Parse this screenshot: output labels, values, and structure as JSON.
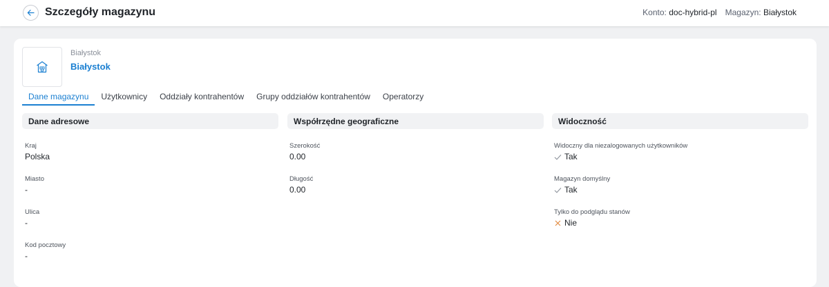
{
  "header": {
    "title": "Szczegóły magazynu",
    "account_label": "Konto:",
    "account_value": "doc-hybrid-pl",
    "warehouse_label": "Magazyn:",
    "warehouse_value": "Białystok"
  },
  "warehouse": {
    "subtitle": "Białystok",
    "name": "Białystok",
    "icon": "warehouse-icon"
  },
  "tabs": [
    {
      "label": "Dane magazynu",
      "active": true
    },
    {
      "label": "Użytkownicy",
      "active": false
    },
    {
      "label": "Oddziały kontrahentów",
      "active": false
    },
    {
      "label": "Grupy oddziałów kontrahentów",
      "active": false
    },
    {
      "label": "Operatorzy",
      "active": false
    }
  ],
  "sections": {
    "address": {
      "title": "Dane adresowe",
      "fields": [
        {
          "label": "Kraj",
          "value": "Polska"
        },
        {
          "label": "Miasto",
          "value": "-"
        },
        {
          "label": "Ulica",
          "value": "-"
        },
        {
          "label": "Kod pocztowy",
          "value": "-"
        }
      ]
    },
    "geo": {
      "title": "Współrzędne geograficzne",
      "fields": [
        {
          "label": "Szerokość",
          "value": "0.00"
        },
        {
          "label": "Długość",
          "value": "0.00"
        }
      ]
    },
    "visibility": {
      "title": "Widoczność",
      "fields": [
        {
          "label": "Widoczny dla niezalogowanych użytkowników",
          "value": "Tak",
          "icon": "check-icon"
        },
        {
          "label": "Magazyn domyślny",
          "value": "Tak",
          "icon": "check-icon"
        },
        {
          "label": "Tylko do podglądu stanów",
          "value": "Nie",
          "icon": "cross-icon"
        }
      ]
    }
  },
  "colors": {
    "accent": "#1a7fd1",
    "check": "#8a9099",
    "cross": "#e0873a"
  }
}
